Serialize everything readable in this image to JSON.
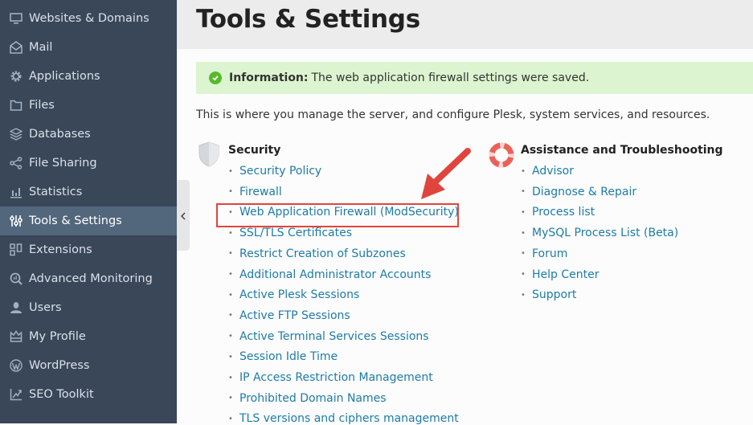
{
  "sidebar": {
    "items": [
      {
        "label": "Websites & Domains",
        "icon": "monitor-icon",
        "active": false
      },
      {
        "label": "Mail",
        "icon": "mail-icon",
        "active": false
      },
      {
        "label": "Applications",
        "icon": "gear-icon",
        "active": false
      },
      {
        "label": "Files",
        "icon": "folder-icon",
        "active": false
      },
      {
        "label": "Databases",
        "icon": "database-layers-icon",
        "active": false
      },
      {
        "label": "File Sharing",
        "icon": "share-icon",
        "active": false
      },
      {
        "label": "Statistics",
        "icon": "bar-chart-icon",
        "active": false
      },
      {
        "label": "Tools & Settings",
        "icon": "sliders-icon",
        "active": true
      },
      {
        "label": "Extensions",
        "icon": "extensions-icon",
        "active": false
      },
      {
        "label": "Advanced Monitoring",
        "icon": "monitoring-icon",
        "active": false
      },
      {
        "label": "Users",
        "icon": "user-icon",
        "active": false
      },
      {
        "label": "My Profile",
        "icon": "crown-icon",
        "active": false
      },
      {
        "label": "WordPress",
        "icon": "wordpress-icon",
        "active": false
      },
      {
        "label": "SEO Toolkit",
        "icon": "seo-chart-icon",
        "active": false
      }
    ]
  },
  "header": {
    "title": "Tools & Settings"
  },
  "info": {
    "label": "Information:",
    "message": "The web application firewall settings were saved."
  },
  "intro": "This is where you manage the server, and configure Plesk, system services, and resources.",
  "sections": {
    "security": {
      "title": "Security",
      "links": [
        "Security Policy",
        "Firewall",
        "Web Application Firewall (ModSecurity)",
        "SSL/TLS Certificates",
        "Restrict Creation of Subzones",
        "Additional Administrator Accounts",
        "Active Plesk Sessions",
        "Active FTP Sessions",
        "Active Terminal Services Sessions",
        "Session Idle Time",
        "IP Access Restriction Management",
        "Prohibited Domain Names",
        "TLS versions and ciphers management"
      ]
    },
    "assistance": {
      "title": "Assistance and Troubleshooting",
      "links": [
        "Advisor",
        "Diagnose & Repair",
        "Process list",
        "MySQL Process List (Beta)",
        "Forum",
        "Help Center",
        "Support"
      ]
    }
  },
  "colors": {
    "sidebar_bg": "#3a4759",
    "sidebar_active": "#52667c",
    "link": "#1d7ba8",
    "info_bg": "#dcf5d0",
    "success": "#58b92d",
    "annotation": "#e0453d"
  }
}
